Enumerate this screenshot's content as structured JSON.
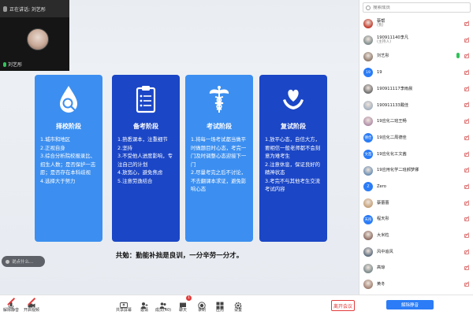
{
  "speaker": {
    "label": "正在讲话: 刘艺彤"
  },
  "video_tile": {
    "name": "刘艺彤"
  },
  "slide": {
    "cards": [
      {
        "title": "择校阶段",
        "icon": "magnifier-drop-icon",
        "items": [
          "1.城市和地区",
          "2.正视自身",
          "3.综合分析院校报录比、招生人数；是否保护一志愿；是否存在本科歧视",
          "4.选择大于努力"
        ]
      },
      {
        "title": "备考阶段",
        "icon": "clipboard-icon",
        "items": [
          "1.熟悉课本，注重细节",
          "2.坚持",
          "3.不受他人进度影响，专注自己的计划",
          "4.放宽心，避免焦虑",
          "5.注意劳逸结合"
        ]
      },
      {
        "title": "考试阶段",
        "icon": "caduceus-icon",
        "items": [
          "1.将每一场考试都当做平时做题目时心态，考完一门及时调整心态迎接下一门",
          "2.尽量考完之后不讨论，不去翻课本求证，避免影响心态"
        ]
      },
      {
        "title": "复试阶段",
        "icon": "heart-hands-icon",
        "items": [
          "1.放平心态，自信大方，要相信一般老师都不会刻意为难考生",
          "2.注意休息，保证良好的精神状态",
          "3.考完不与其他考生交流考试内容"
        ]
      }
    ],
    "motto": "共勉：勤能补拙是良训，一分辛劳一分才。"
  },
  "chat_preview": {
    "text": "说点什么..."
  },
  "toolbar": {
    "buttons": [
      {
        "label": "解除静音",
        "icon": "mic-muted-icon"
      },
      {
        "label": "开启视频",
        "icon": "camera-off-icon"
      },
      {
        "label": "共享屏幕",
        "icon": "share-screen-icon"
      },
      {
        "label": "邀请",
        "icon": "invite-icon"
      },
      {
        "label": "成员(40)",
        "icon": "members-icon"
      },
      {
        "label": "聊天",
        "icon": "chat-icon",
        "badge": "1"
      },
      {
        "label": "录制",
        "icon": "record-icon"
      },
      {
        "label": "应用",
        "icon": "apps-icon"
      },
      {
        "label": "设置",
        "icon": "settings-icon"
      }
    ],
    "leave_label": "离开会议",
    "unmute_all_label": "解除静音"
  },
  "participants_panel": {
    "search_placeholder": "搜索成员",
    "participants": [
      {
        "name": "蔡帮",
        "role": "(我)",
        "avatar": "photo",
        "color": "#c0392b"
      },
      {
        "name": "190911140李凡",
        "role": "(主持人)",
        "avatar": "photo",
        "color": "#7f8c8d"
      },
      {
        "name": "刘艺彤",
        "role": "",
        "avatar": "photo",
        "color": "#8e7b6c",
        "mic_on": true
      },
      {
        "name": "19",
        "role": "",
        "avatar": "19",
        "color": "#2b7cf6"
      },
      {
        "name": "190911117李雨晨",
        "role": "",
        "avatar": "photo",
        "color": "#6d6d6d"
      },
      {
        "name": "190911133戴佳",
        "role": "",
        "avatar": "photo",
        "color": "#a4b0be"
      },
      {
        "name": "19应化二班王畅",
        "role": "",
        "avatar": "photo",
        "color": "#b08ea8"
      },
      {
        "name": "19应化二周德佳",
        "role": "",
        "avatar": "德佳",
        "color": "#2b7cf6"
      },
      {
        "name": "19应化化工文茜",
        "role": "",
        "avatar": "文茜",
        "color": "#2b7cf6"
      },
      {
        "name": "19应用化学二班郝梦娜",
        "role": "",
        "avatar": "photo",
        "color": "#6c8fb3"
      },
      {
        "name": "Zero",
        "role": "",
        "avatar": "Z",
        "color": "#2b7cf6"
      },
      {
        "name": "蔡蕾蕾",
        "role": "",
        "avatar": "photo",
        "color": "#c4a07a"
      },
      {
        "name": "程天彤",
        "role": "",
        "avatar": "天彤",
        "color": "#2b7cf6"
      },
      {
        "name": "大米粒",
        "role": "",
        "avatar": "photo",
        "color": "#8d6e63"
      },
      {
        "name": "风中追风",
        "role": "",
        "avatar": "photo",
        "color": "#5d6d7e"
      },
      {
        "name": "高琼",
        "role": "",
        "avatar": "photo",
        "color": "#7b8a8b"
      },
      {
        "name": "黄冬",
        "role": "",
        "avatar": "photo",
        "color": "#a08070"
      }
    ]
  }
}
